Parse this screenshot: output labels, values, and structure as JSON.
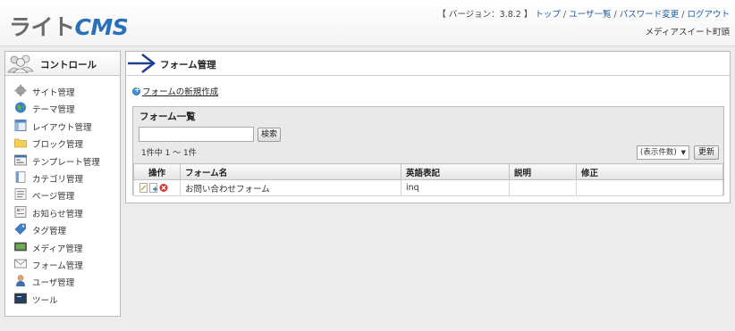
{
  "header": {
    "logo_kana": "ライト",
    "logo_cms": "CMS",
    "version": "【 バージョン：3.8.2 】",
    "nav": [
      {
        "label": "トップ"
      },
      {
        "label": "ユーザ一覧"
      },
      {
        "label": "パスワード変更"
      },
      {
        "label": "ログアウト"
      }
    ],
    "separator": " / ",
    "site_name": "メディアスイート町頭"
  },
  "sidebar": {
    "title": "コントロール",
    "items": [
      {
        "label": "サイト管理",
        "icon": "gear-icon"
      },
      {
        "label": "テーマ管理",
        "icon": "globe-icon"
      },
      {
        "label": "レイアウト管理",
        "icon": "layout-icon"
      },
      {
        "label": "ブロック管理",
        "icon": "folder-icon"
      },
      {
        "label": "テンプレート管理",
        "icon": "template-icon"
      },
      {
        "label": "カテゴリ管理",
        "icon": "category-icon"
      },
      {
        "label": "ページ管理",
        "icon": "page-icon"
      },
      {
        "label": "お知らせ管理",
        "icon": "notice-icon"
      },
      {
        "label": "タグ管理",
        "icon": "tag-icon"
      },
      {
        "label": "メディア管理",
        "icon": "media-icon"
      },
      {
        "label": "フォーム管理",
        "icon": "mail-icon"
      },
      {
        "label": "ユーザ管理",
        "icon": "user-icon"
      },
      {
        "label": "ツール",
        "icon": "tool-icon"
      }
    ]
  },
  "main": {
    "title": "フォーム管理",
    "new_link": "フォームの新規作成",
    "list_title": "フォーム一覧",
    "search": {
      "value": "",
      "button": "検索"
    },
    "count": "1件中 1 ～ 1件",
    "per_page": "(表示件数)",
    "update_button": "更新",
    "columns": [
      "操作",
      "フォーム名",
      "英語表記",
      "説明",
      "修正"
    ],
    "rows": [
      {
        "name": "お問い合わせフォーム",
        "english": "inq",
        "description": "",
        "modified": ""
      }
    ]
  },
  "colors": {
    "link": "#1a5fa8",
    "logo_blue": "#2b6fba",
    "delete": "#d9342b"
  }
}
